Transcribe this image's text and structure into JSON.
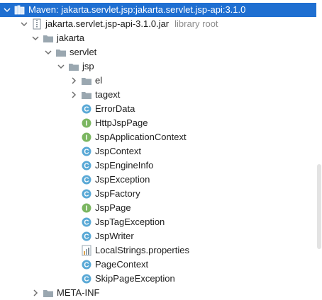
{
  "tree": {
    "library": {
      "label": "Maven: jakarta.servlet.jsp:jakarta.servlet.jsp-api:3.1.0",
      "icon": "library-icon",
      "expanded": true,
      "selected": true
    },
    "jar": {
      "label": "jakarta.servlet.jsp-api-3.1.0.jar",
      "hint": "library root",
      "icon": "jar-icon",
      "expanded": true
    },
    "packages": [
      {
        "label": "jakarta",
        "icon": "package-folder-icon",
        "expanded": true
      },
      {
        "label": "servlet",
        "icon": "package-folder-icon",
        "expanded": true
      },
      {
        "label": "jsp",
        "icon": "package-folder-icon",
        "expanded": true
      },
      {
        "label": "el",
        "icon": "package-folder-icon",
        "expanded": false
      },
      {
        "label": "tagext",
        "icon": "package-folder-icon",
        "expanded": false
      }
    ],
    "items": [
      {
        "label": "ErrorData",
        "kind": "class",
        "letter": "C"
      },
      {
        "label": "HttpJspPage",
        "kind": "interface",
        "letter": "I"
      },
      {
        "label": "JspApplicationContext",
        "kind": "interface",
        "letter": "I"
      },
      {
        "label": "JspContext",
        "kind": "class",
        "letter": "C"
      },
      {
        "label": "JspEngineInfo",
        "kind": "class",
        "letter": "C"
      },
      {
        "label": "JspException",
        "kind": "class",
        "letter": "C"
      },
      {
        "label": "JspFactory",
        "kind": "class",
        "letter": "C"
      },
      {
        "label": "JspPage",
        "kind": "interface",
        "letter": "I"
      },
      {
        "label": "JspTagException",
        "kind": "class",
        "letter": "C"
      },
      {
        "label": "JspWriter",
        "kind": "class",
        "letter": "C"
      },
      {
        "label": "LocalStrings.properties",
        "kind": "properties",
        "letter": ""
      },
      {
        "label": "PageContext",
        "kind": "class",
        "letter": "C"
      },
      {
        "label": "SkipPageException",
        "kind": "class",
        "letter": "C"
      }
    ],
    "meta_inf": {
      "label": "META-INF",
      "icon": "folder-icon",
      "expanded": false
    }
  },
  "colors": {
    "selection": "#1f6fd1",
    "class_icon": "#5aa9d6",
    "interface_icon": "#7bb661",
    "folder_icon": "#9aa7b0",
    "hint_text": "#8c8c8c"
  }
}
